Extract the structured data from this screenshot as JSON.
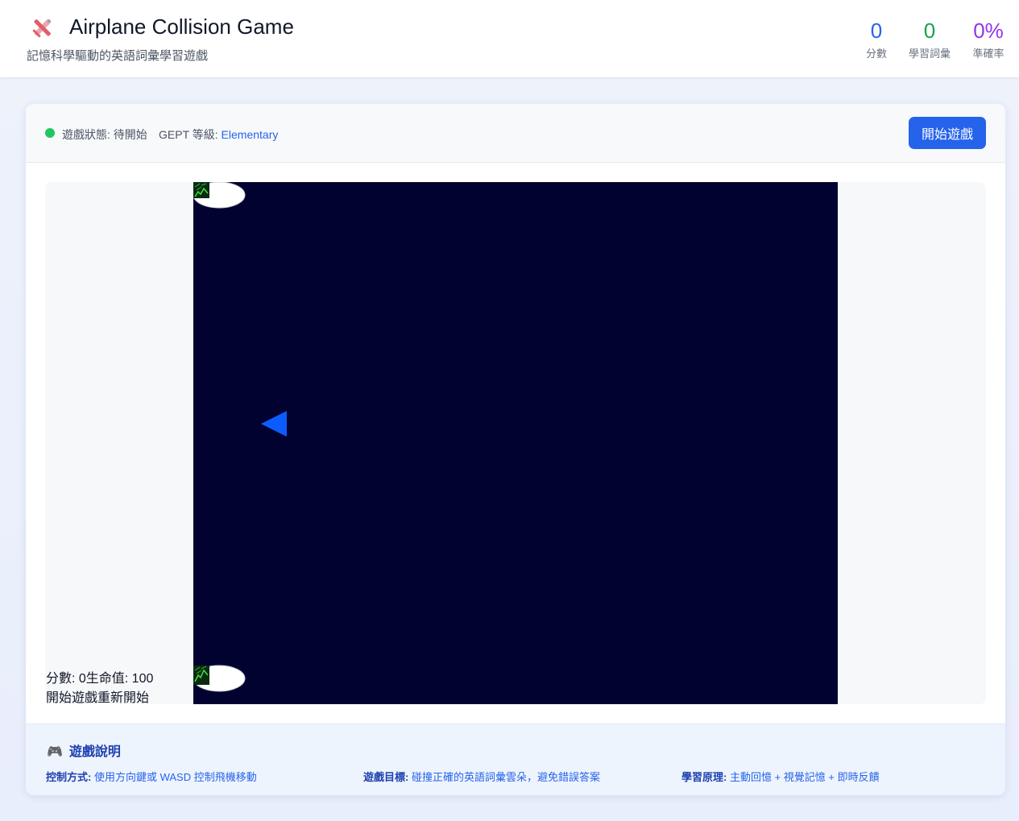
{
  "header": {
    "title": "Airplane Collision Game",
    "subtitle": "記憶科學驅動的英語詞彙學習遊戲",
    "stats": {
      "score_value": "0",
      "score_label": "分數",
      "words_value": "0",
      "words_label": "學習詞彙",
      "accuracy_value": "0%",
      "accuracy_label": "準確率"
    }
  },
  "toolbar": {
    "status": "遊戲狀態: 待開始",
    "level_label": "GEPT 等級: ",
    "level_value": "Elementary",
    "start_label": "開始遊戲"
  },
  "game": {
    "hud_line1": "分數: 0生命值: 100",
    "hud_line2": "開始遊戲重新開始"
  },
  "help": {
    "title": "遊戲說明",
    "controls_label": "控制方式:",
    "controls_text": " 使用方向鍵或 WASD 控制飛機移動",
    "goal_label": "遊戲目標:",
    "goal_text": " 碰撞正確的英語詞彙雲朵，避免錯誤答案",
    "principle_label": "學習原理:",
    "principle_text": " 主動回憶 + 視覺記憶 + 即時反饋"
  },
  "colors": {
    "accent": "#2563eb",
    "status_ready": "#22c55e",
    "canvas_bg": "#020230",
    "plane": "#0a5cff"
  }
}
